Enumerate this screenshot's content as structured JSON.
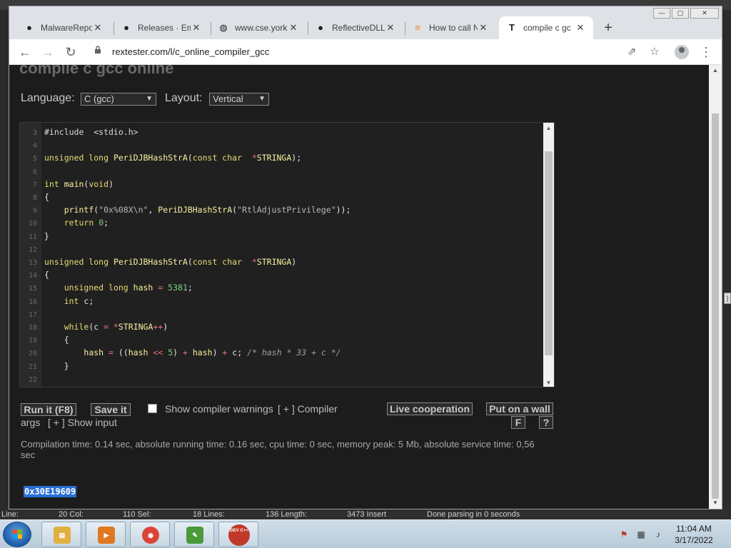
{
  "background_ide": {
    "status_bar": {
      "line_label": "Line:",
      "col_label": "20 Col:",
      "sel_label": "110 Sel:",
      "lines_label": "18 Lines:",
      "length_label": "136 Length:",
      "insert_label": "3473 Insert",
      "parse_message": "Done parsing in 0 seconds"
    },
    "side_marker": "}"
  },
  "window_controls": {
    "minimize": "—",
    "maximize": "▢",
    "close": "✕"
  },
  "tabs": [
    {
      "icon": "github-icon",
      "glyph": "●",
      "title": "MalwareRepo",
      "close": "✕"
    },
    {
      "icon": "github-icon",
      "glyph": "●",
      "title": "Releases · Em",
      "close": "✕"
    },
    {
      "icon": "globe-icon",
      "glyph": "◍",
      "title": "www.cse.york",
      "close": "✕"
    },
    {
      "icon": "github-icon",
      "glyph": "●",
      "title": "ReflectiveDLL",
      "close": "✕"
    },
    {
      "icon": "stackoverflow-icon",
      "glyph": "≡",
      "title": "How to call N",
      "close": "✕"
    },
    {
      "icon": "rextester-icon",
      "glyph": "T",
      "title": "compile c gc",
      "close": "✕",
      "active": true
    }
  ],
  "new_tab": "+",
  "toolbar": {
    "back": "←",
    "forward": "→",
    "reload": "↻",
    "url": "rextester.com/l/c_online_compiler_gcc",
    "share": "⇗",
    "bookmark": "☆",
    "menu": "⋮"
  },
  "page": {
    "title": "compile c gcc online",
    "language_label": "Language:",
    "language_value": "C (gcc)",
    "layout_label": "Layout:",
    "layout_value": "Vertical",
    "editor_lines": [
      {
        "n": "3",
        "html": "<span class='tk-prep'>#include  &lt;stdio.h&gt;</span>"
      },
      {
        "n": "4",
        "html": ""
      },
      {
        "n": "5",
        "html": "<span class='tk-kw'>unsigned long</span> <span class='tk-fn'>PeriDJBHashStrA</span>(<span class='tk-kw'>const char</span>  <span class='tk-op'>*</span><span class='tk-fn'>STRINGA</span>);"
      },
      {
        "n": "6",
        "html": ""
      },
      {
        "n": "7",
        "html": "<span class='tk-kw'>int</span> <span class='tk-fn'>main</span>(<span class='tk-kw'>void</span>)"
      },
      {
        "n": "8",
        "html": "{"
      },
      {
        "n": "9",
        "html": "    <span class='tk-fn'>printf</span>(<span class='tk-str'>\"0x%08X\\n\"</span>, <span class='tk-fn'>PeriDJBHashStrA</span>(<span class='tk-str'>\"RtlAdjustPrivilege\"</span>));"
      },
      {
        "n": "10",
        "html": "    <span class='tk-kw'>return</span> <span class='tk-num'>0</span>;"
      },
      {
        "n": "11",
        "html": "}"
      },
      {
        "n": "12",
        "html": ""
      },
      {
        "n": "13",
        "html": "<span class='tk-kw'>unsigned long</span> <span class='tk-fn'>PeriDJBHashStrA</span>(<span class='tk-kw'>const char</span>  <span class='tk-op'>*</span><span class='tk-fn'>STRINGA</span>)"
      },
      {
        "n": "14",
        "html": "{"
      },
      {
        "n": "15",
        "html": "    <span class='tk-kw'>unsigned long</span> <span class='tk-fn'>hash</span> <span class='tk-op'>=</span> <span class='tk-num'>5381</span>;"
      },
      {
        "n": "16",
        "html": "    <span class='tk-kw'>int</span> c;"
      },
      {
        "n": "17",
        "html": ""
      },
      {
        "n": "18",
        "html": "    <span class='tk-kw'>while</span>(c <span class='tk-op'>=</span> <span class='tk-op'>*</span><span class='tk-fn'>STRINGA</span><span class='tk-op'>++</span>)"
      },
      {
        "n": "19",
        "html": "    {"
      },
      {
        "n": "20",
        "html": "        <span class='tk-fn'>hash</span> <span class='tk-op'>=</span> ((<span class='tk-fn'>hash</span> <span class='tk-op'>&lt;&lt;</span> <span class='tk-num'>5</span>) <span class='tk-op'>+</span> <span class='tk-fn'>hash</span>) <span class='tk-op'>+</span> c; <span class='tk-cm'>/* hash * 33 + c */</span>"
      },
      {
        "n": "21",
        "html": "    }"
      },
      {
        "n": "22",
        "html": ""
      }
    ],
    "run_button": "Run it (F8)",
    "save_button": "Save it",
    "show_warnings_label": "Show compiler warnings",
    "compiler_args_prefix": "[ + ] Compiler",
    "compiler_args_suffix": "args",
    "show_input_label": "[ + ] Show input",
    "live_cooperation_button": "Live cooperation",
    "put_on_wall_button": "Put on a wall",
    "fullscreen_button": "F",
    "help_button": "?",
    "stats_text": "Compilation time: 0.14 sec, absolute running time: 0.16 sec, cpu time: 0 sec, memory peak: 5 Mb, absolute service time: 0,56 sec",
    "output": "0x30E19609"
  },
  "taskbar": {
    "items": [
      {
        "name": "explorer",
        "icon": "folder-icon",
        "glyph": "▤",
        "color": "#e0b040"
      },
      {
        "name": "media-player",
        "icon": "media-player-icon",
        "glyph": "▶",
        "color": "#e07820"
      },
      {
        "name": "chrome",
        "icon": "chrome-icon",
        "glyph": "◉",
        "color": "#db4437"
      },
      {
        "name": "notepad",
        "icon": "notepad-icon",
        "glyph": "✎",
        "color": "#4a9a3a"
      },
      {
        "name": "devcpp",
        "icon": "devcpp-icon",
        "glyph": "DEV C++",
        "color": "#c0392b"
      }
    ],
    "tray": {
      "flag": "⚑",
      "network": "▦",
      "volume": "♪"
    },
    "time": "11:04 AM",
    "date": "3/17/2022"
  }
}
